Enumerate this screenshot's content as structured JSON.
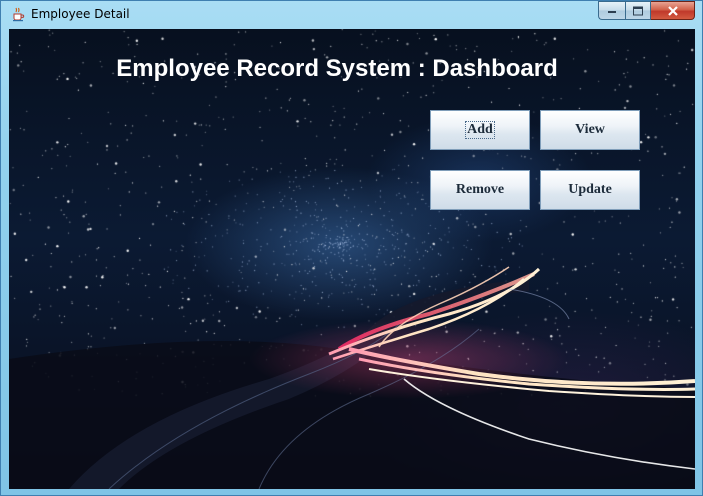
{
  "window": {
    "title": "Employee Detail",
    "controls": [
      "minimize",
      "maximize",
      "close"
    ],
    "app_icon": "java-cup-icon"
  },
  "dashboard": {
    "heading": "Employee Record System : Dashboard",
    "buttons": {
      "add": "Add",
      "view": "View",
      "remove": "Remove",
      "update": "Update"
    },
    "focused_button": "add",
    "background": "night-sky-light-trails"
  }
}
